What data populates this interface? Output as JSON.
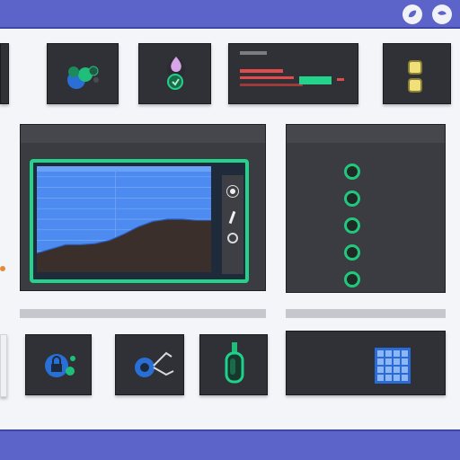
{
  "colors": {
    "accent": "#5c63c9",
    "green": "#23d38c",
    "blue": "#2f73d6",
    "card": "#2f3136",
    "warn": "#e04b4b"
  },
  "topbar": {
    "icons": [
      "leaf-icon",
      "leaf-icon"
    ]
  },
  "cards_top": [
    {
      "name": "app-card-1"
    },
    {
      "name": "app-card-2"
    },
    {
      "name": "app-card-3",
      "line1": "",
      "line2": ""
    },
    {
      "name": "app-card-4"
    }
  ],
  "main_panel": {
    "title": "",
    "right_label": "",
    "tools": [
      "circle-icon",
      "slash-icon",
      "refresh-icon"
    ]
  },
  "side_panel": {
    "title": "",
    "rows": [
      {
        "label": "",
        "value": ""
      },
      {
        "label": "",
        "value": ""
      },
      {
        "label": "",
        "value": ""
      },
      {
        "label": "",
        "value": ""
      },
      {
        "label": "",
        "value": ""
      }
    ]
  },
  "cards_bottom": [
    {
      "name": "app-card-5"
    },
    {
      "name": "app-card-6"
    },
    {
      "name": "app-card-7"
    }
  ],
  "info_card": {
    "title": "",
    "lines": [
      "",
      ""
    ]
  },
  "chart_data": {
    "type": "area",
    "title": "",
    "xlabel": "",
    "ylabel": "",
    "x": [
      0,
      1,
      2,
      3,
      4,
      5,
      6,
      7,
      8,
      9,
      10,
      11,
      12
    ],
    "values": [
      18,
      22,
      26,
      26,
      27,
      30,
      36,
      43,
      48,
      50,
      50,
      49,
      49
    ],
    "ylim": [
      0,
      100
    ],
    "grid": true
  }
}
